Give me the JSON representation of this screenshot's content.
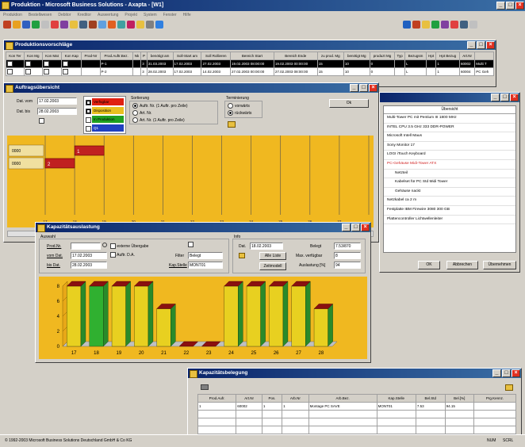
{
  "app": {
    "title": "Produktion - Microsoft Business Solutions - Axapta - [W1]",
    "menu": [
      "Produktion",
      "Bestellwesen",
      "Debitor",
      "Kreditor",
      "Auswertung",
      "Projekt",
      "System",
      "Fenster",
      "Hilfe"
    ],
    "statusbar": {
      "copyright": "© 1992-2003 Microsoft Business Solutions Deutschland GmbH & Co KG",
      "num": "NUM",
      "scrl": "SCRL"
    }
  },
  "produktion": {
    "title": "Produktionsvorschläge",
    "headers": [
      "Kon Ter",
      "Kon Mg",
      "Kon Mat",
      "Kon Kap",
      "Prod-Nr",
      "Prod.Auftr.Bez.",
      "Nk",
      "P",
      "benötigt am",
      "Soll-Start am",
      "Soll Rollieren",
      "Bereich Start",
      "Bereich Ende",
      "zu prod. Mg",
      "benötigt Mg",
      "produzt Mg",
      "Typ",
      "Bezugsm",
      "Hpt",
      "Hpt Bezug",
      "Art.Nr",
      ""
    ],
    "rows": [
      [
        "",
        "",
        "",
        "",
        "",
        "P-1",
        "",
        "3",
        "31.03.2003",
        "17.02.2003",
        "27.02.2003",
        "19.02.2003 08:00:00",
        "19.02.2003 00:00:00",
        "15",
        "10",
        "0",
        "",
        "L",
        "",
        "1",
        "60002",
        "Multi T"
      ],
      [
        "",
        "",
        "",
        "",
        "",
        "P-2",
        "",
        "3",
        "28.02.2003",
        "17.02.2003",
        "14.02.2003",
        "27.02.2003 00:00:00",
        "27.02.2003 08:00:00",
        "15",
        "10",
        "0",
        "",
        "L",
        "",
        "1",
        "60004",
        "PC Geh"
      ]
    ]
  },
  "auftrag": {
    "title": "Auftragsübersicht",
    "dat_von_label": "Dat. vom",
    "dat_von": "17.02.2003",
    "dat_bis_label": "Dat. bis",
    "dat_bis": "28.02.2003",
    "legend": [
      {
        "label": "Verfügbar",
        "color": "#e02010",
        "checked": true
      },
      {
        "label": "Disposition",
        "color": "#e8c020",
        "checked": true
      },
      {
        "label": "In Produktion",
        "color": "#20a020",
        "checked": false
      },
      {
        "label": "Q1",
        "color": "#2040c0",
        "checked": false
      }
    ],
    "sortierung_label": "Sortierung",
    "sortierung": [
      "Auftr. Nr. (1 Auftr. pro Zeile)",
      "Art. Nr.",
      "Art. Nr. (1 Auftr. pro Zeile)"
    ],
    "terminierung_label": "Terminierung",
    "terminierung": [
      "vorwärts",
      "rückwärts"
    ],
    "ok": "Ok",
    "rows": [
      "0000",
      "0000"
    ],
    "bars": [
      "1",
      "2"
    ],
    "ticks": [
      "17",
      "18",
      "19",
      "20",
      "21",
      "22",
      "23",
      "24",
      "25",
      "26",
      "27"
    ]
  },
  "uebersicht": {
    "title": "Übersicht",
    "items": [
      {
        "text": "Multi-Tower PC mit Pentium III 1800 MHz",
        "color": "#000",
        "bold": false,
        "indent": 0
      },
      {
        "text": "INTEL CPU 3.5 GHz 333 DDR-POWER",
        "color": "#000",
        "bold": false,
        "indent": 0
      },
      {
        "text": "Microsoft Intell Maus",
        "color": "#000",
        "bold": false,
        "indent": 0
      },
      {
        "text": "Sony Monitor 17",
        "color": "#000",
        "bold": false,
        "indent": 0
      },
      {
        "text": "LOGI iTouch Keyboard",
        "color": "#000",
        "bold": false,
        "indent": 0
      },
      {
        "text": "PC-Gehäuse Midi-Tower ATX",
        "color": "#d02020",
        "bold": false,
        "indent": 0
      },
      {
        "text": "Netzteil",
        "color": "#000",
        "bold": false,
        "indent": 1
      },
      {
        "text": "Kabelset für PC Std Midi Tower",
        "color": "#000",
        "bold": false,
        "indent": 1
      },
      {
        "text": "Gehäuse nackt",
        "color": "#000",
        "bold": false,
        "indent": 1
      },
      {
        "text": "Netzkabel ca 2 m",
        "color": "#000",
        "bold": false,
        "indent": 0
      },
      {
        "text": "Festplatte IBM Firewire 3080 300 GB",
        "color": "#000",
        "bold": false,
        "indent": 0
      },
      {
        "text": "Plattencontroller Lichtwellenleiter",
        "color": "#000",
        "bold": false,
        "indent": 0
      }
    ],
    "ok": "OK",
    "abbrechen": "Abbrechen",
    "uebernehmen": "Übernehmen"
  },
  "kapazitaet": {
    "title": "Kapazitätsauslastung",
    "auswahl_label": "Auswahl",
    "prodnr_label": "Prod.Nr.",
    "prodnr": "",
    "externe_label": "externe Übergabe",
    "auftr_label": "Auftr. D.A.",
    "vom_label": "vom Dat.",
    "vom": "17.02.2003",
    "bis_label": "bis Dat.",
    "bis": "28.02.2003",
    "filter_label": "Filter",
    "filter": "Belegt",
    "kapstelle_label": "Kap.Stelle",
    "kapstelle": "MONT01",
    "info_label": "Info",
    "dat_label": "Dat.",
    "dat": "18.02.2003",
    "belegt_label": "Belegt",
    "belegt": "7.53/870",
    "alle_liste": "Alle Liste",
    "max_label": "Max. verfügbar",
    "max": "8",
    "zeitmodell": "Zeitmodell",
    "auslastung_label": "Auslastung [%]",
    "auslastung": "94"
  },
  "belegung": {
    "title": "Kapazitätsbelegung",
    "headers": [
      "Prod.Aufr.",
      "Art.Nr",
      "Pos.",
      "Arb.Nr",
      "Arb.Bez.",
      "Kap.Stelle",
      "Bel.Std",
      "Bel.[%]",
      "Prg.Kennz."
    ],
    "rows": [
      [
        "1",
        "60002",
        "1",
        "1",
        "Montage PC SAVE",
        "MONT01",
        "7.53",
        "94.15",
        ""
      ]
    ]
  },
  "chart_data": {
    "type": "bar",
    "categories": [
      "17",
      "18",
      "19",
      "20",
      "21",
      "22",
      "23",
      "24",
      "25",
      "26",
      "27",
      "28"
    ],
    "values": [
      8,
      8,
      8,
      8,
      5,
      0,
      0,
      8,
      8,
      8,
      8,
      5
    ],
    "highlight": [
      false,
      true,
      false,
      false,
      false,
      false,
      false,
      false,
      false,
      false,
      false,
      false
    ],
    "ylim": [
      0,
      8
    ],
    "yticks": [
      "0",
      "2",
      "4",
      "6",
      "8"
    ],
    "colors": {
      "bar": "#e8d020",
      "side": "#2a8a2a",
      "top": "#8a1010",
      "highlight": "#30b030",
      "bg": "#f0b820"
    }
  }
}
